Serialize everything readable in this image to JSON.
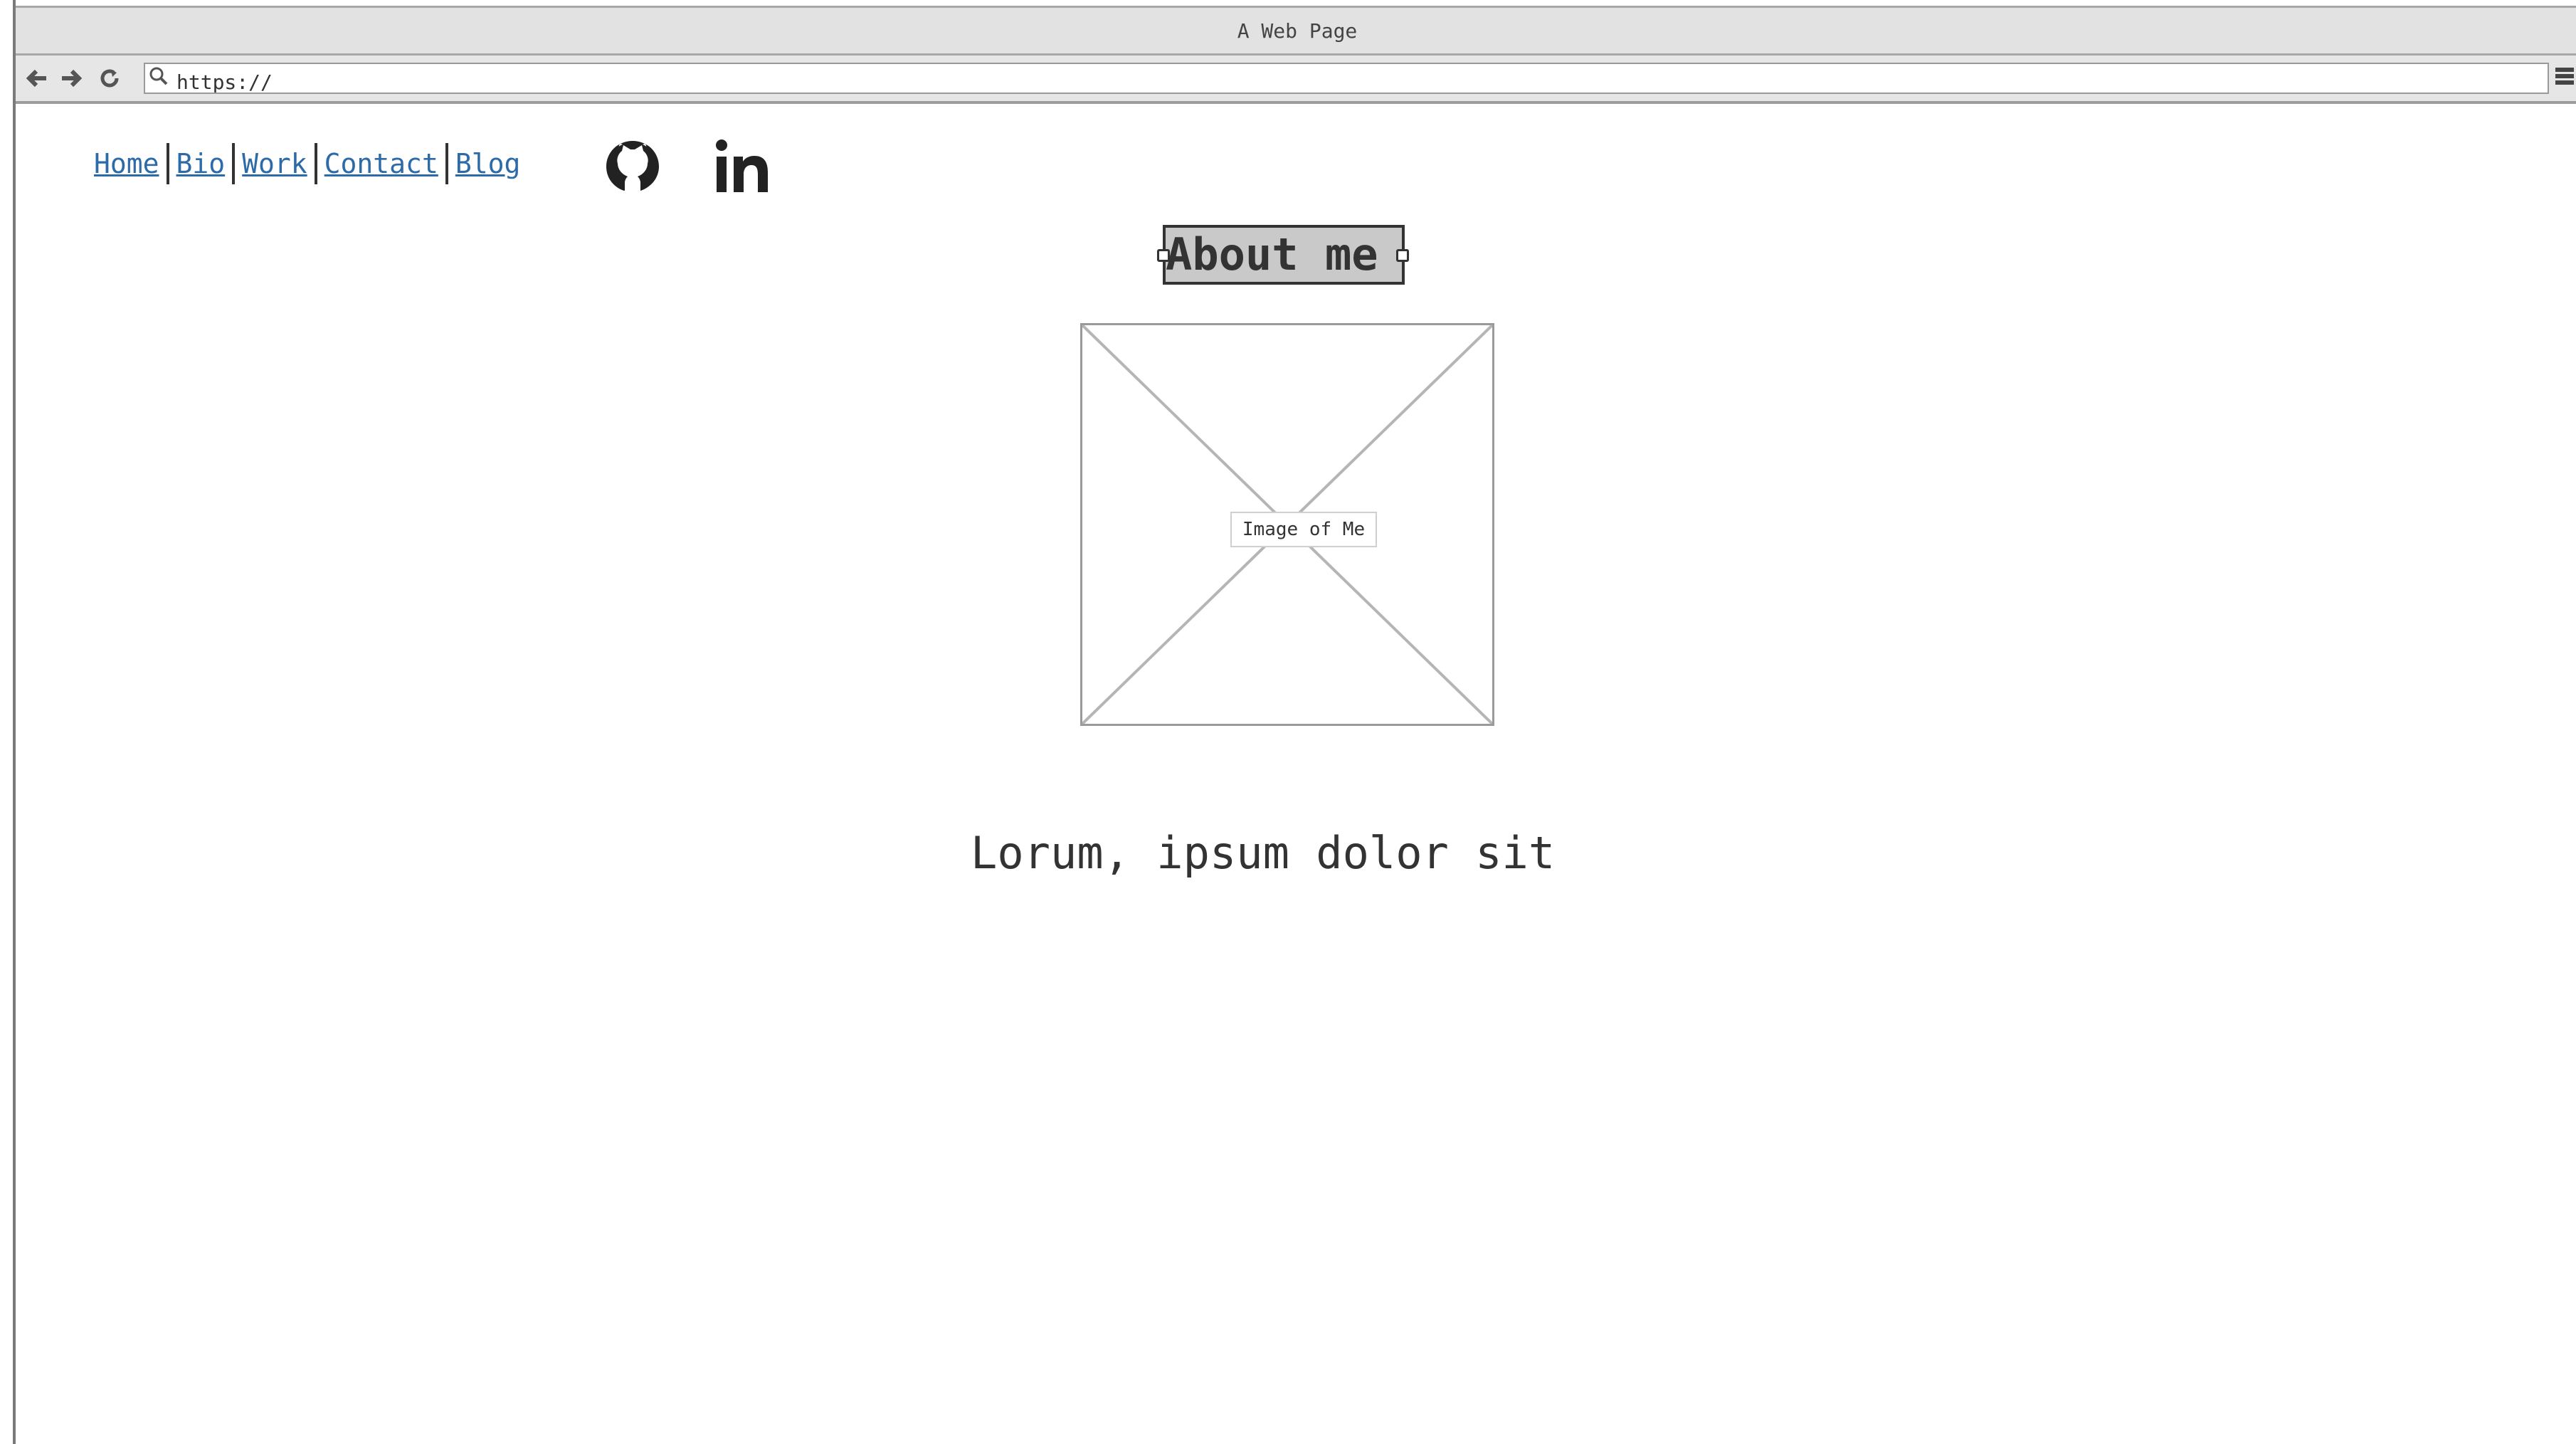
{
  "browser": {
    "title": "A Web Page",
    "url": "https://",
    "back_icon": "arrow-left-icon",
    "forward_icon": "arrow-right-icon",
    "reload_icon": "reload-icon",
    "menu_icon": "hamburger-menu-icon"
  },
  "nav": {
    "links": [
      {
        "label": "Home"
      },
      {
        "label": "Bio"
      },
      {
        "label": "Work"
      },
      {
        "label": "Contact"
      },
      {
        "label": "Blog"
      }
    ],
    "link_color": "#2d6aa8"
  },
  "social": {
    "github_icon": "github-icon",
    "linkedin_icon": "linkedin-icon",
    "linkedin_text": "in"
  },
  "main": {
    "heading": "About me",
    "image_label": "Image of Me",
    "tagline": "Lorum, ipsum dolor sit"
  }
}
